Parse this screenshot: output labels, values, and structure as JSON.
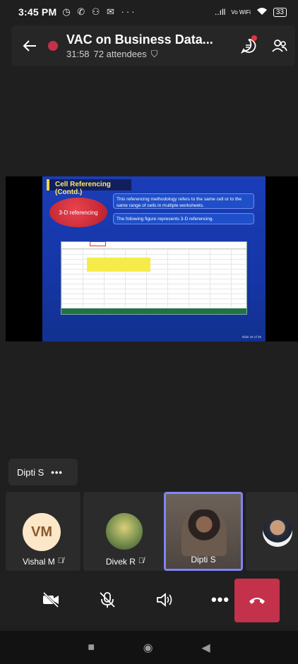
{
  "status_bar": {
    "time": "3:45 PM",
    "icons": "◷ ✆ ⚇ ✉ ···",
    "signal": "..ıll",
    "volte": "Vo WiFi",
    "battery": "33"
  },
  "header": {
    "title": "VAC on Business Data...",
    "duration": "31:58",
    "attendees": "72 attendees"
  },
  "slide": {
    "title": "Cell Referencing (Contd.)",
    "callout": "3-D referencing",
    "text1": "This referencing methodology refers to the same cell or to the same range of cells in multiple worksheets.",
    "text2": "The following figure represents 3-D referencing.",
    "footer": "Slide 25 of 36"
  },
  "presenter_chip": {
    "name": "Dipti S",
    "more": "•••"
  },
  "participants": [
    {
      "initials": "VM",
      "name": "Vishal M",
      "muted": true
    },
    {
      "name": "Divek R",
      "muted": true
    },
    {
      "name": "Dipti S",
      "muted": false,
      "active_speaker": true
    },
    {
      "name": "",
      "muted": false
    }
  ],
  "controls": {
    "more": "•••",
    "hangup_color": "#c4314b"
  },
  "colors": {
    "accent": "#7f85f5",
    "record": "#c4314b"
  }
}
